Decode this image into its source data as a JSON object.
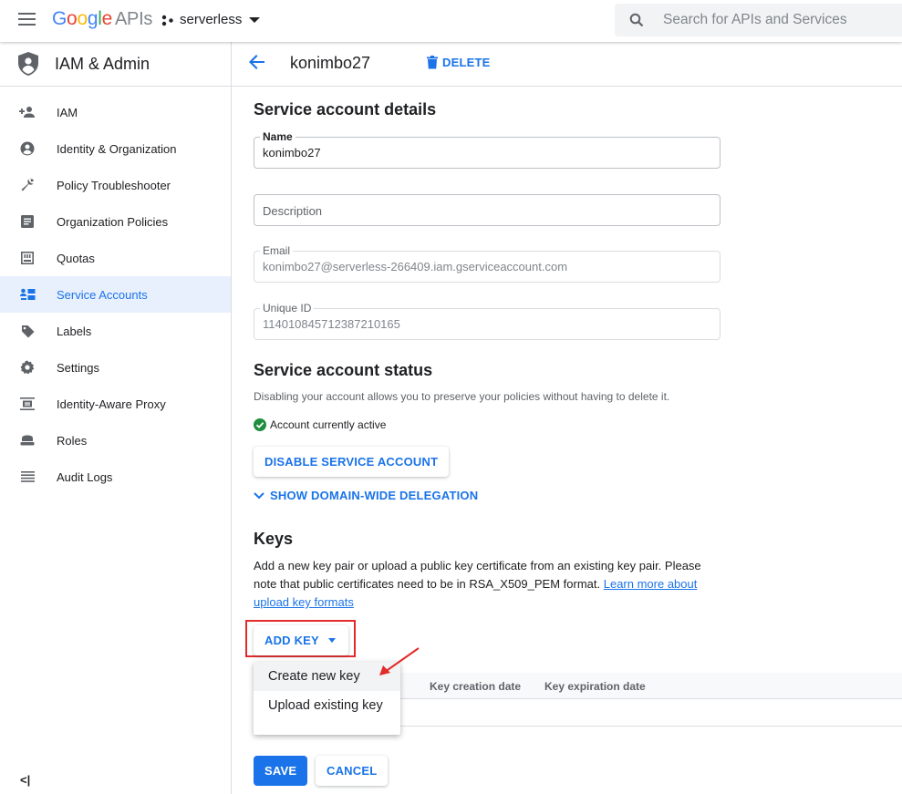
{
  "topbar": {
    "logo_google": "Google",
    "logo_apis": "APIs",
    "project": "serverless",
    "search_placeholder": "Search for APIs and Services"
  },
  "sidebar": {
    "title": "IAM & Admin",
    "items": [
      {
        "label": "IAM",
        "icon": "person-add-icon"
      },
      {
        "label": "Identity & Organization",
        "icon": "account-circle-icon"
      },
      {
        "label": "Policy Troubleshooter",
        "icon": "wrench-icon"
      },
      {
        "label": "Organization Policies",
        "icon": "document-icon"
      },
      {
        "label": "Quotas",
        "icon": "quota-icon"
      },
      {
        "label": "Service Accounts",
        "icon": "service-account-icon",
        "active": true
      },
      {
        "label": "Labels",
        "icon": "tag-icon"
      },
      {
        "label": "Settings",
        "icon": "gear-icon"
      },
      {
        "label": "Identity-Aware Proxy",
        "icon": "proxy-icon"
      },
      {
        "label": "Roles",
        "icon": "roles-icon"
      },
      {
        "label": "Audit Logs",
        "icon": "list-icon"
      }
    ],
    "collapse_label": "<|"
  },
  "header": {
    "account_name": "konimbo27",
    "delete_label": "DELETE"
  },
  "details": {
    "heading": "Service account details",
    "name_label": "Name",
    "name_value": "konimbo27",
    "description_placeholder": "Description",
    "email_label": "Email",
    "email_value": "konimbo27@serverless-266409.iam.gserviceaccount.com",
    "uniqueid_label": "Unique ID",
    "uniqueid_value": "114010845712387210165"
  },
  "status": {
    "heading": "Service account status",
    "description": "Disabling your account allows you to preserve your policies without having to delete it.",
    "active_text": "Account currently active",
    "disable_button": "DISABLE SERVICE ACCOUNT",
    "delegation_toggle": "SHOW DOMAIN-WIDE DELEGATION"
  },
  "keys": {
    "heading": "Keys",
    "description": "Add a new key pair or upload a public key certificate from an existing key pair. Please note that public certificates need to be in RSA_X509_PEM format.",
    "learn_more_link": "Learn more about upload key formats",
    "add_key_button": "ADD KEY",
    "columns": [
      "Key creation date",
      "Key expiration date"
    ],
    "menu_items": [
      "Create new key",
      "Upload existing key"
    ]
  },
  "footer": {
    "save_button": "SAVE",
    "cancel_button": "CANCEL"
  },
  "colors": {
    "accent": "#1a73e8",
    "active_bg": "#e8f0fe",
    "annotation_red": "#e32b2b",
    "success_green": "#1e8e3e"
  }
}
